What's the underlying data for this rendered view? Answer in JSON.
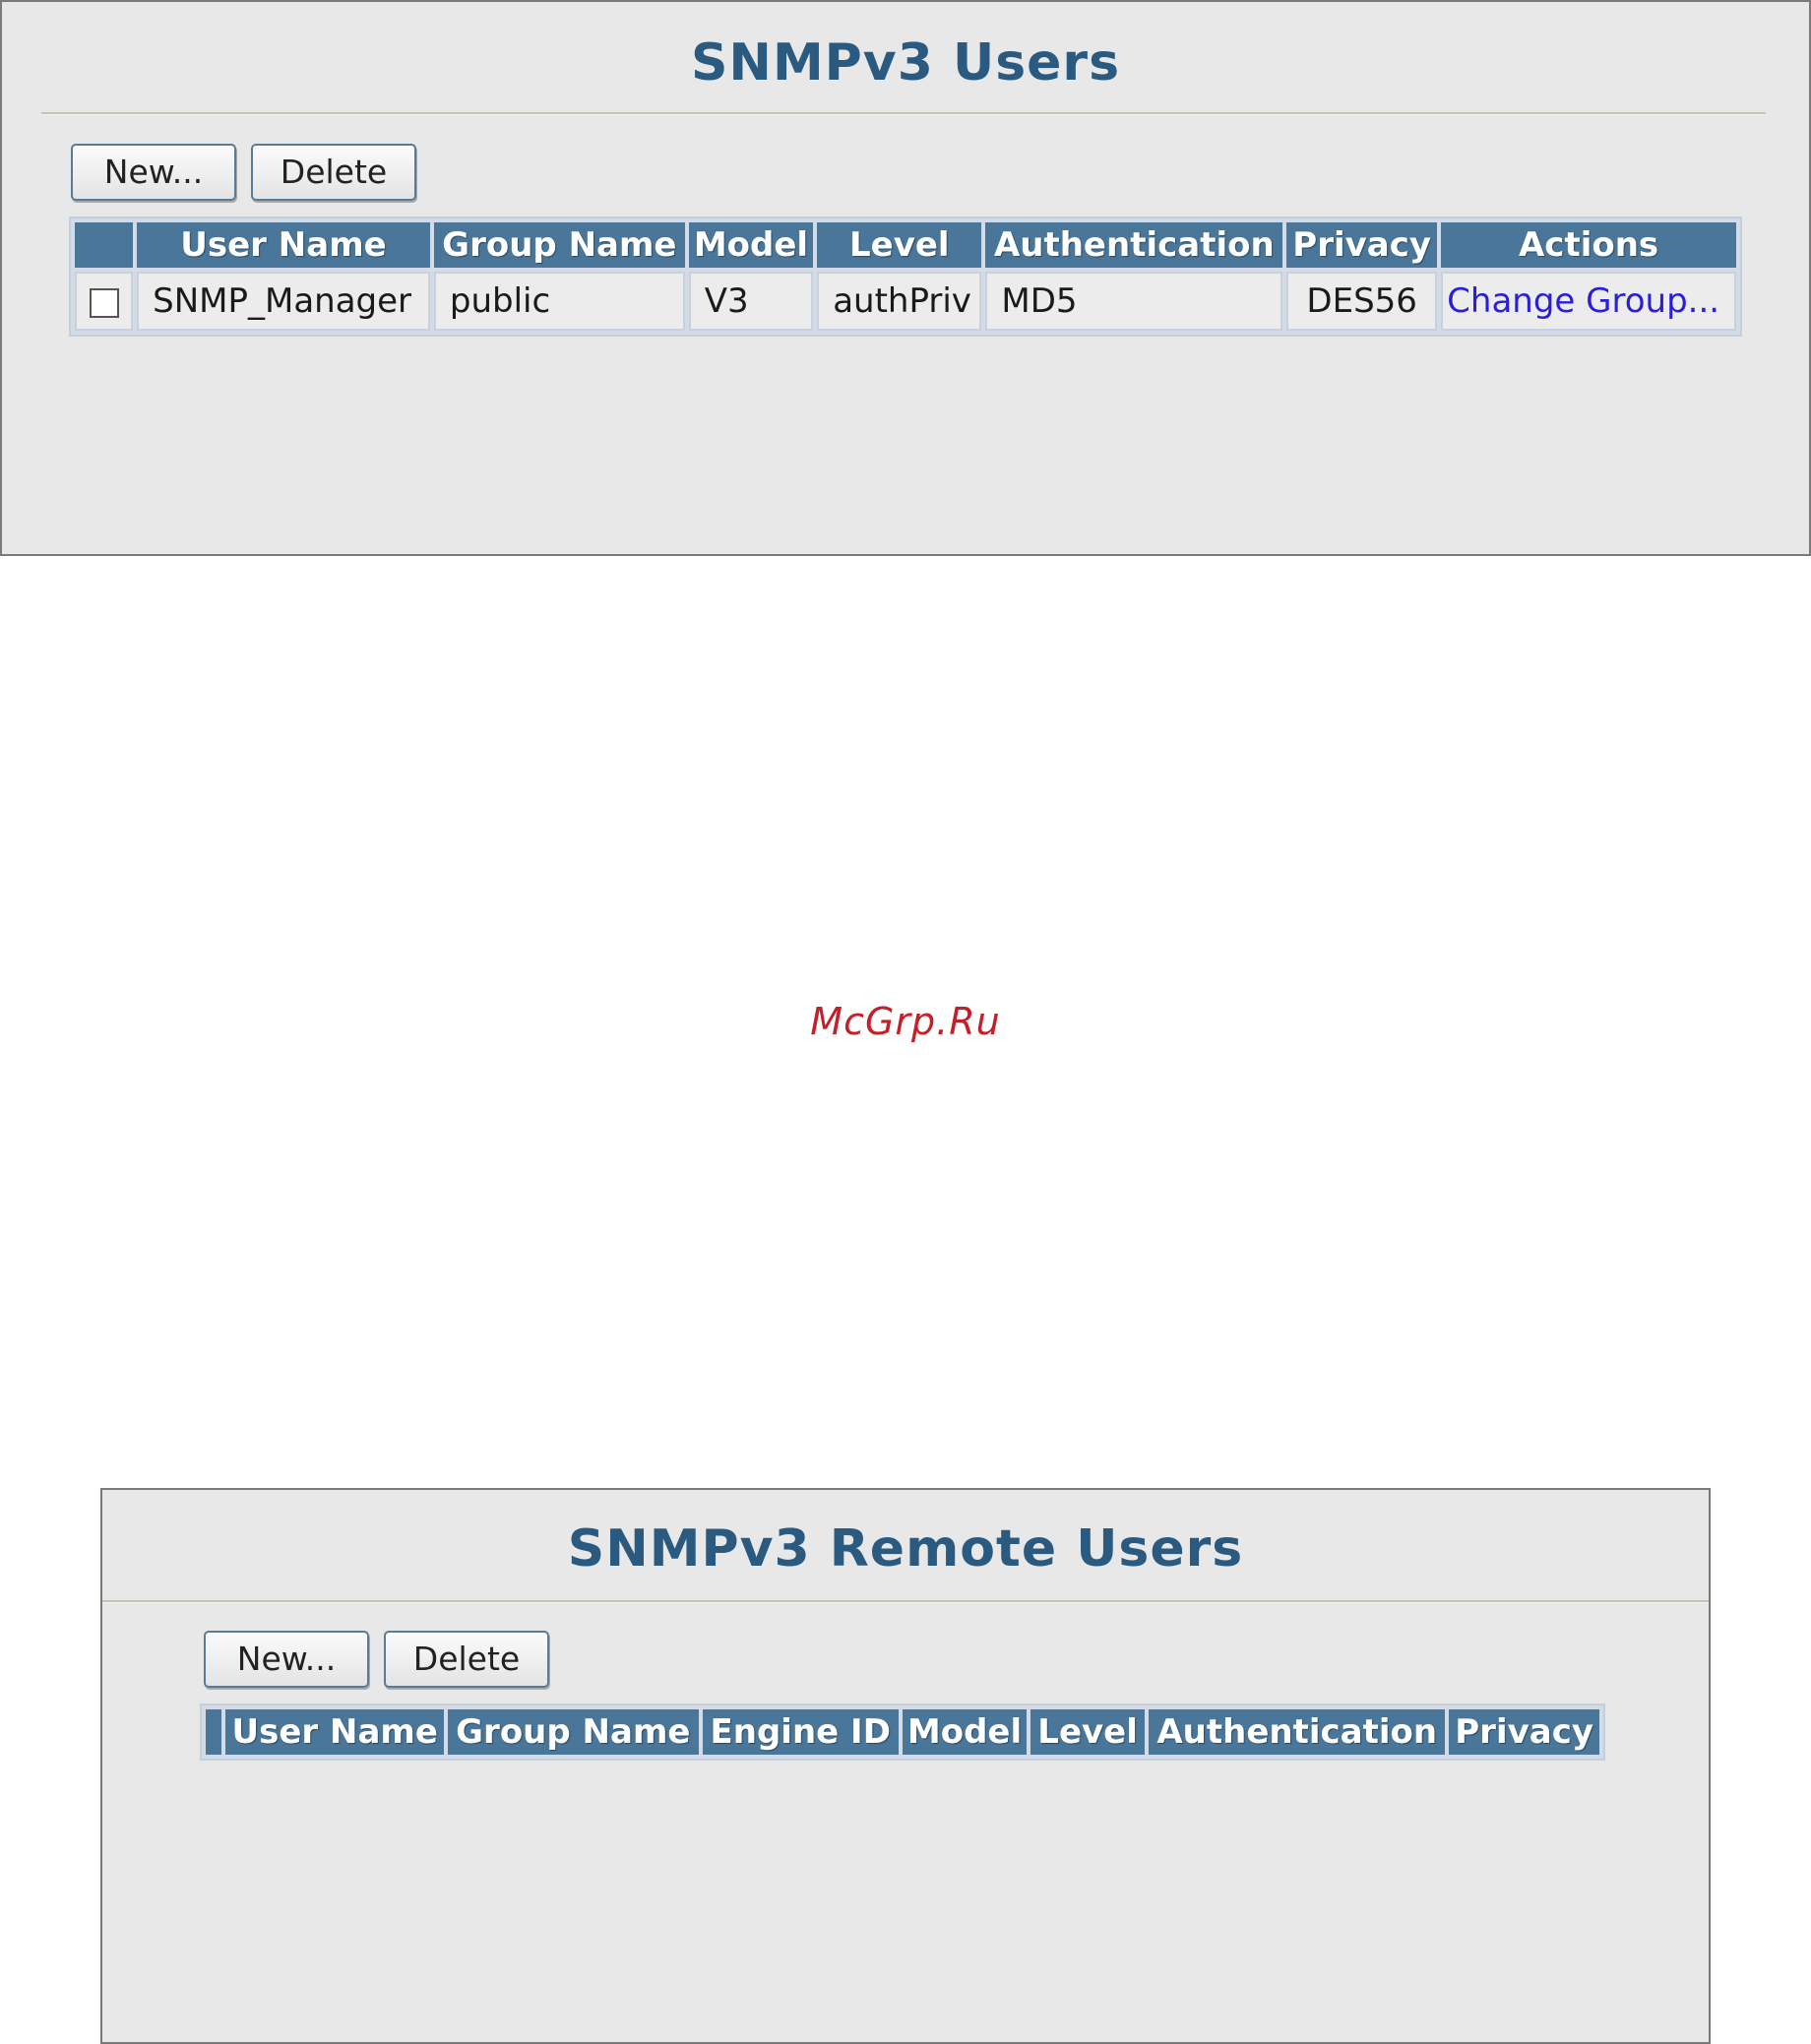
{
  "users_panel": {
    "title": "SNMPv3 Users",
    "new_label": "New...",
    "delete_label": "Delete",
    "columns": [
      "",
      "User Name",
      "Group Name",
      "Model",
      "Level",
      "Authentication",
      "Privacy",
      "Actions"
    ],
    "rows": [
      {
        "checked": false,
        "user_name": "SNMP_Manager",
        "group_name": "public",
        "model": "V3",
        "level": "authPriv",
        "authentication": "MD5",
        "privacy": "DES56",
        "action": "Change Group..."
      }
    ]
  },
  "watermark": "McGrp.Ru",
  "remote_panel": {
    "title": "SNMPv3 Remote Users",
    "new_label": "New...",
    "delete_label": "Delete",
    "columns": [
      "",
      "User Name",
      "Group Name",
      "Engine ID",
      "Model",
      "Level",
      "Authentication",
      "Privacy"
    ],
    "rows": []
  },
  "colors": {
    "title": "#2a5a80",
    "header_bg": "#4a7799",
    "link": "#2a1fd8",
    "watermark": "#c4202a"
  }
}
